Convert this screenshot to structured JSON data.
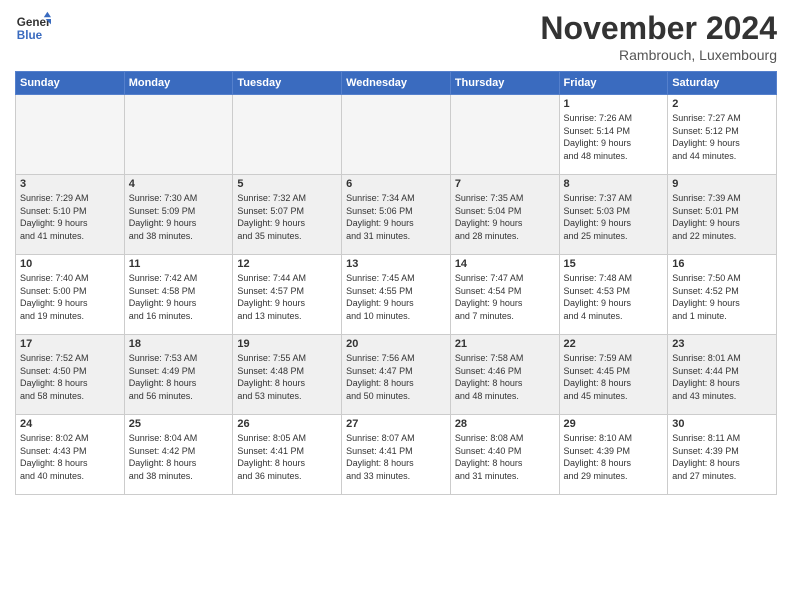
{
  "header": {
    "logo_line1": "General",
    "logo_line2": "Blue",
    "month": "November 2024",
    "location": "Rambrouch, Luxembourg"
  },
  "weekdays": [
    "Sunday",
    "Monday",
    "Tuesday",
    "Wednesday",
    "Thursday",
    "Friday",
    "Saturday"
  ],
  "weeks": [
    [
      {
        "day": "",
        "info": ""
      },
      {
        "day": "",
        "info": ""
      },
      {
        "day": "",
        "info": ""
      },
      {
        "day": "",
        "info": ""
      },
      {
        "day": "",
        "info": ""
      },
      {
        "day": "1",
        "info": "Sunrise: 7:26 AM\nSunset: 5:14 PM\nDaylight: 9 hours\nand 48 minutes."
      },
      {
        "day": "2",
        "info": "Sunrise: 7:27 AM\nSunset: 5:12 PM\nDaylight: 9 hours\nand 44 minutes."
      }
    ],
    [
      {
        "day": "3",
        "info": "Sunrise: 7:29 AM\nSunset: 5:10 PM\nDaylight: 9 hours\nand 41 minutes."
      },
      {
        "day": "4",
        "info": "Sunrise: 7:30 AM\nSunset: 5:09 PM\nDaylight: 9 hours\nand 38 minutes."
      },
      {
        "day": "5",
        "info": "Sunrise: 7:32 AM\nSunset: 5:07 PM\nDaylight: 9 hours\nand 35 minutes."
      },
      {
        "day": "6",
        "info": "Sunrise: 7:34 AM\nSunset: 5:06 PM\nDaylight: 9 hours\nand 31 minutes."
      },
      {
        "day": "7",
        "info": "Sunrise: 7:35 AM\nSunset: 5:04 PM\nDaylight: 9 hours\nand 28 minutes."
      },
      {
        "day": "8",
        "info": "Sunrise: 7:37 AM\nSunset: 5:03 PM\nDaylight: 9 hours\nand 25 minutes."
      },
      {
        "day": "9",
        "info": "Sunrise: 7:39 AM\nSunset: 5:01 PM\nDaylight: 9 hours\nand 22 minutes."
      }
    ],
    [
      {
        "day": "10",
        "info": "Sunrise: 7:40 AM\nSunset: 5:00 PM\nDaylight: 9 hours\nand 19 minutes."
      },
      {
        "day": "11",
        "info": "Sunrise: 7:42 AM\nSunset: 4:58 PM\nDaylight: 9 hours\nand 16 minutes."
      },
      {
        "day": "12",
        "info": "Sunrise: 7:44 AM\nSunset: 4:57 PM\nDaylight: 9 hours\nand 13 minutes."
      },
      {
        "day": "13",
        "info": "Sunrise: 7:45 AM\nSunset: 4:55 PM\nDaylight: 9 hours\nand 10 minutes."
      },
      {
        "day": "14",
        "info": "Sunrise: 7:47 AM\nSunset: 4:54 PM\nDaylight: 9 hours\nand 7 minutes."
      },
      {
        "day": "15",
        "info": "Sunrise: 7:48 AM\nSunset: 4:53 PM\nDaylight: 9 hours\nand 4 minutes."
      },
      {
        "day": "16",
        "info": "Sunrise: 7:50 AM\nSunset: 4:52 PM\nDaylight: 9 hours\nand 1 minute."
      }
    ],
    [
      {
        "day": "17",
        "info": "Sunrise: 7:52 AM\nSunset: 4:50 PM\nDaylight: 8 hours\nand 58 minutes."
      },
      {
        "day": "18",
        "info": "Sunrise: 7:53 AM\nSunset: 4:49 PM\nDaylight: 8 hours\nand 56 minutes."
      },
      {
        "day": "19",
        "info": "Sunrise: 7:55 AM\nSunset: 4:48 PM\nDaylight: 8 hours\nand 53 minutes."
      },
      {
        "day": "20",
        "info": "Sunrise: 7:56 AM\nSunset: 4:47 PM\nDaylight: 8 hours\nand 50 minutes."
      },
      {
        "day": "21",
        "info": "Sunrise: 7:58 AM\nSunset: 4:46 PM\nDaylight: 8 hours\nand 48 minutes."
      },
      {
        "day": "22",
        "info": "Sunrise: 7:59 AM\nSunset: 4:45 PM\nDaylight: 8 hours\nand 45 minutes."
      },
      {
        "day": "23",
        "info": "Sunrise: 8:01 AM\nSunset: 4:44 PM\nDaylight: 8 hours\nand 43 minutes."
      }
    ],
    [
      {
        "day": "24",
        "info": "Sunrise: 8:02 AM\nSunset: 4:43 PM\nDaylight: 8 hours\nand 40 minutes."
      },
      {
        "day": "25",
        "info": "Sunrise: 8:04 AM\nSunset: 4:42 PM\nDaylight: 8 hours\nand 38 minutes."
      },
      {
        "day": "26",
        "info": "Sunrise: 8:05 AM\nSunset: 4:41 PM\nDaylight: 8 hours\nand 36 minutes."
      },
      {
        "day": "27",
        "info": "Sunrise: 8:07 AM\nSunset: 4:41 PM\nDaylight: 8 hours\nand 33 minutes."
      },
      {
        "day": "28",
        "info": "Sunrise: 8:08 AM\nSunset: 4:40 PM\nDaylight: 8 hours\nand 31 minutes."
      },
      {
        "day": "29",
        "info": "Sunrise: 8:10 AM\nSunset: 4:39 PM\nDaylight: 8 hours\nand 29 minutes."
      },
      {
        "day": "30",
        "info": "Sunrise: 8:11 AM\nSunset: 4:39 PM\nDaylight: 8 hours\nand 27 minutes."
      }
    ]
  ]
}
